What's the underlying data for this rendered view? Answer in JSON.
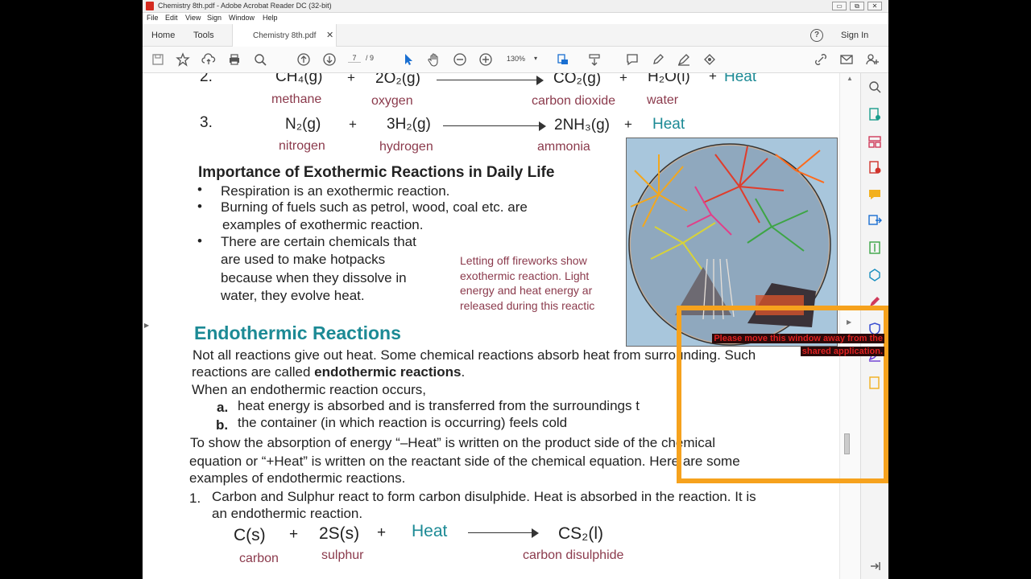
{
  "window": {
    "title": "Chemistry 8th.pdf - Adobe Acrobat Reader DC (32-bit)",
    "controls": [
      "▭",
      "⧉",
      "✕"
    ]
  },
  "menu": [
    "File",
    "Edit",
    "View",
    "Sign",
    "Window",
    "Help"
  ],
  "tabs": {
    "home": "Home",
    "tools": "Tools",
    "document": "Chemistry 8th.pdf",
    "close": "✕"
  },
  "header": {
    "help": "?",
    "sign_in": "Sign In"
  },
  "toolbar": {
    "page_current": "7",
    "page_total": "/ 9",
    "zoom": "130%",
    "zoom_dropdown": "▾"
  },
  "document": {
    "eq2": {
      "number": "2.",
      "reactant1": "CH₄(g)",
      "plus1": "+",
      "reactant2": "2O₂(g)",
      "product1": "CO₂(g)",
      "plus2": "+",
      "product2": "H₂O(l)",
      "plus3": "+",
      "heat": "Heat",
      "label_r1": "methane",
      "label_r2": "oxygen",
      "label_p1": "carbon dioxide",
      "label_p2": "water"
    },
    "eq3": {
      "number": "3.",
      "reactant1": "N₂(g)",
      "plus1": "+",
      "reactant2": "3H₂(g)",
      "product1": "2NH₃(g)",
      "plus2": "+",
      "heat": "Heat",
      "label_r1": "nitrogen",
      "label_r2": "hydrogen",
      "label_p1": "ammonia"
    },
    "importance_heading": "Importance of Exothermic Reactions in Daily Life",
    "bullets": [
      "Respiration is an exothermic reaction.",
      "Burning of fuels such as petrol, wood, coal etc. are",
      "examples of exothermic reaction.",
      "There are certain chemicals that",
      "are used to make hotpacks",
      "because when they dissolve in",
      "water, they evolve heat."
    ],
    "bullet_char": "•",
    "caption": [
      "Letting off fireworks show",
      "exothermic reaction. Light",
      "energy and heat energy ar",
      "released during this reactic"
    ],
    "endo_heading": "Endothermic Reactions",
    "endo_p1a": "Not all reactions give out heat. Some chemical reactions absorb heat from surrounding. Such",
    "endo_p1b": "reactions are called ",
    "endo_p1b_bold": "endothermic reactions",
    "endo_p1b_end": ".",
    "endo_when": "When an endothermic reaction occurs,",
    "list_a_marker": "a.",
    "list_a": "heat energy is absorbed and is transferred from the surroundings t",
    "list_b_marker": "b.",
    "list_b": "the container (in which reaction is occurring) feels cold",
    "show_p1": "To show the absorption of energy “–Heat” is written on the product side of the chemical",
    "show_p2": "equation or “+Heat” is written on the reactant side of the chemical equation. Here are some",
    "show_p3": "examples of endothermic reactions.",
    "ex1_num": "1.",
    "ex1_l1": "Carbon and Sulphur react to form carbon disulphide. Heat is absorbed in the reaction. It is",
    "ex1_l2": "an endothermic reaction.",
    "eqc": {
      "reactant1": "C(s)",
      "plus1": "+",
      "reactant2": "2S(s)",
      "plus2": "+",
      "heat": "Heat",
      "product1": "CS₂(l)",
      "label_r1": "carbon",
      "label_r2": "sulphur",
      "label_p1": "carbon disulphide"
    }
  },
  "overlay": {
    "line1": "Please move this window away from the",
    "line2": "shared application."
  },
  "scroll": {
    "up": "▲",
    "down": "▼"
  },
  "side": {
    "collapse_left": "▶",
    "collapse_right": "▶"
  },
  "colors": {
    "accent_orange": "#f6a21d",
    "teal_heading": "#1c8a95",
    "maroon_label": "#8b3a4c",
    "warning_red": "#e02020"
  }
}
